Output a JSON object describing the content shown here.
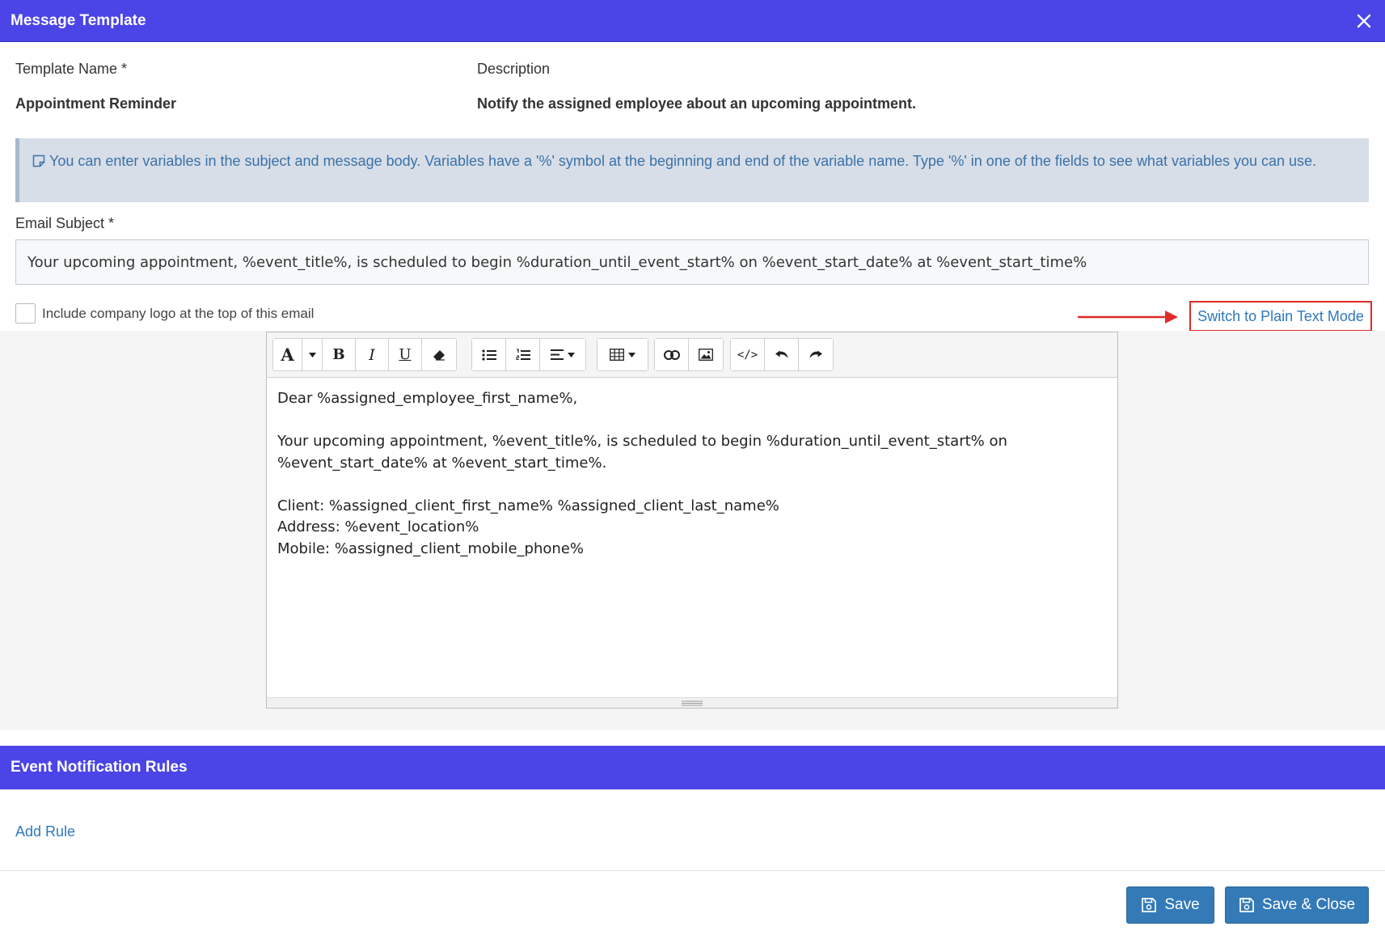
{
  "dialog": {
    "title": "Message Template"
  },
  "template_name": {
    "label": "Template Name *",
    "value": "Appointment Reminder"
  },
  "description": {
    "label": "Description",
    "value": "Notify the assigned employee about an upcoming appointment."
  },
  "info": {
    "text": "You can enter variables in the subject and message body. Variables have a '%' symbol at the beginning and end of the variable name. Type '%' in one of the fields to see what variables you can use."
  },
  "email_subject": {
    "label": "Email Subject *",
    "value": "Your upcoming appointment, %event_title%, is scheduled to begin %duration_until_event_start% on %event_start_date% at %event_start_time%"
  },
  "logo_option": {
    "label": "Include company logo at the top of this email",
    "checked": false
  },
  "switch_mode": {
    "label": "Switch to Plain Text Mode"
  },
  "editor": {
    "toolbar": {
      "font_color_glyph": "A",
      "bold_glyph": "B",
      "italic_glyph": "I",
      "underline_glyph": "U",
      "code_glyph": "</>"
    },
    "body_lines": [
      "Dear %assigned_employee_first_name%,",
      "",
      "Your upcoming appointment, %event_title%, is scheduled to begin %duration_until_event_start% on",
      "%event_start_date% at %event_start_time%.",
      "",
      "Client: %assigned_client_first_name% %assigned_client_last_name%",
      "Address: %event_location%",
      "Mobile: %assigned_client_mobile_phone%"
    ]
  },
  "rules_section": {
    "title": "Event Notification Rules",
    "add_rule_label": "Add Rule"
  },
  "footer": {
    "save_label": "Save",
    "save_close_label": "Save & Close"
  },
  "colors": {
    "header_bg": "#4b44e6",
    "link": "#2e78bd",
    "button_bg": "#337ab7",
    "highlight_red": "#e02b2b",
    "info_bg": "#d8dee8"
  },
  "icons": [
    "close-icon",
    "note-icon",
    "font-color-icon",
    "dropdown-caret-icon",
    "bold-icon",
    "italic-icon",
    "underline-icon",
    "eraser-icon",
    "bullet-list-icon",
    "numbered-list-icon",
    "align-icon",
    "table-icon",
    "link-icon",
    "image-icon",
    "code-icon",
    "undo-icon",
    "redo-icon",
    "resize-handle-icon",
    "save-icon",
    "arrow-right-icon"
  ]
}
